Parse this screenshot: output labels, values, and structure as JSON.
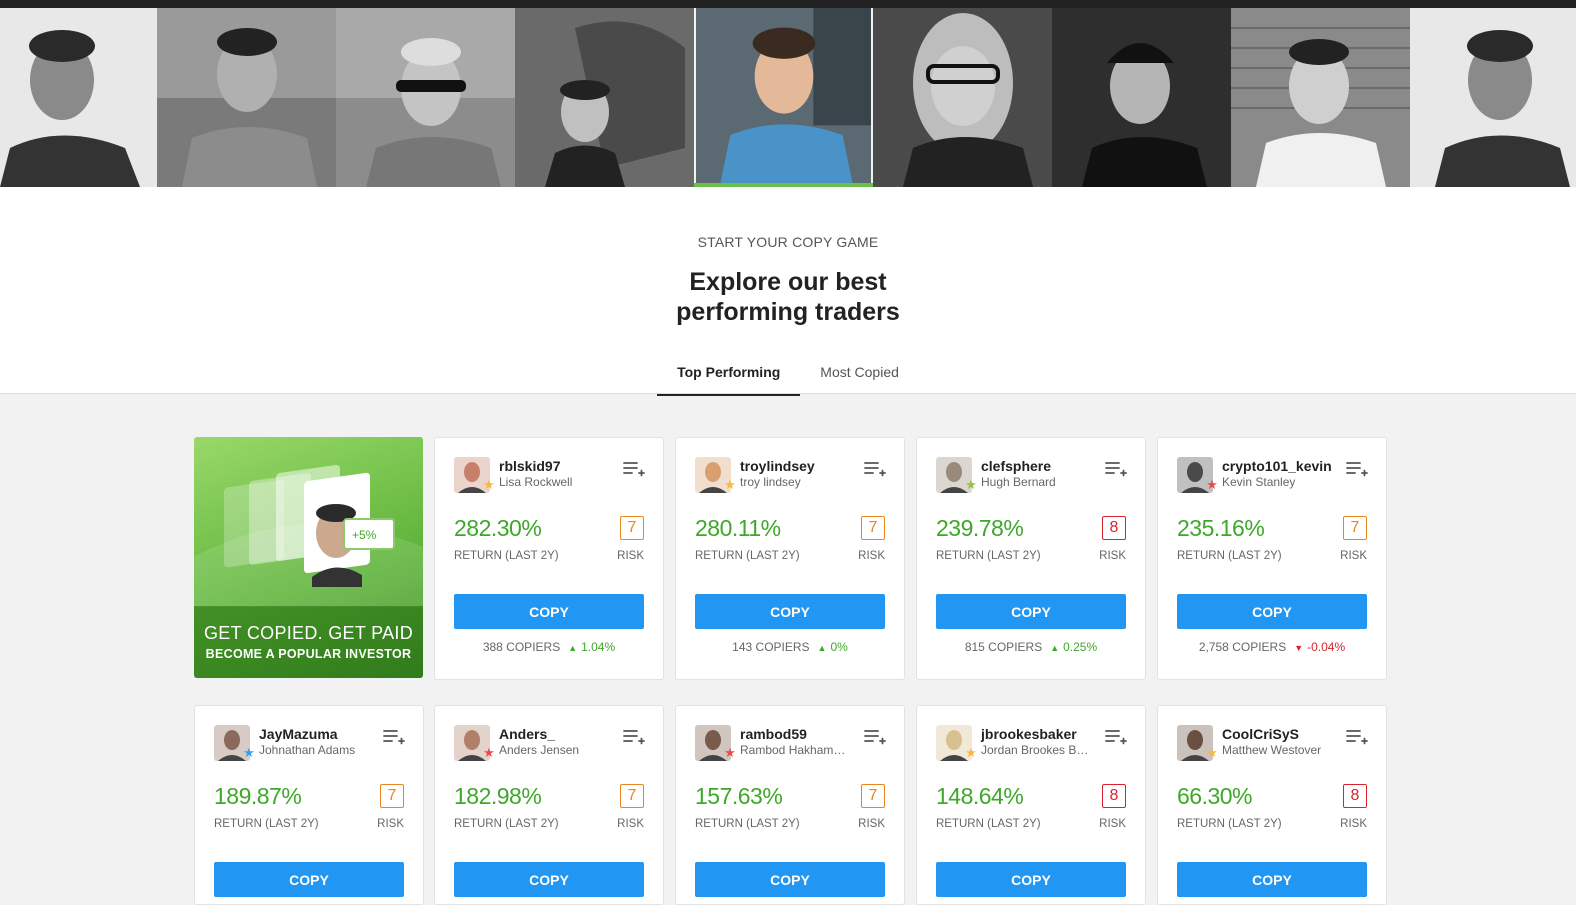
{
  "hero": {
    "kicker": "START YOUR COPY GAME",
    "headline_line1": "Explore our best",
    "headline_line2": "performing traders"
  },
  "tabs": [
    {
      "label": "Top Performing",
      "active": true
    },
    {
      "label": "Most Copied",
      "active": false
    }
  ],
  "promo": {
    "line1": "GET COPIED. GET PAID",
    "line2": "BECOME A POPULAR INVESTOR",
    "tag": "+5%"
  },
  "traders": [
    {
      "username": "rblskid97",
      "name": "Lisa Rockwell",
      "return": "282.30%",
      "return_label": "RETURN (LAST 2Y)",
      "risk": "7",
      "risk_label": "RISK",
      "copy_label": "COPY",
      "copiers": "388 COPIERS",
      "change": "1.04%",
      "direction": "up",
      "badge_color": "#f5b942"
    },
    {
      "username": "troylindsey",
      "name": "troy lindsey",
      "return": "280.11%",
      "return_label": "RETURN (LAST 2Y)",
      "risk": "7",
      "risk_label": "RISK",
      "copy_label": "COPY",
      "copiers": "143 COPIERS",
      "change": "0%",
      "direction": "up",
      "badge_color": "#f5b942"
    },
    {
      "username": "clefsphere",
      "name": "Hugh Bernard",
      "return": "239.78%",
      "return_label": "RETURN (LAST 2Y)",
      "risk": "8",
      "risk_label": "RISK",
      "copy_label": "COPY",
      "copiers": "815 COPIERS",
      "change": "0.25%",
      "direction": "up",
      "badge_color": "#8dc63f"
    },
    {
      "username": "crypto101_kevin",
      "name": "Kevin Stanley",
      "return": "235.16%",
      "return_label": "RETURN (LAST 2Y)",
      "risk": "7",
      "risk_label": "RISK",
      "copy_label": "COPY",
      "copiers": "2,758 COPIERS",
      "change": "-0.04%",
      "direction": "down",
      "badge_color": "#e84c4c"
    },
    {
      "username": "JayMazuma",
      "name": "Johnathan Adams",
      "return": "189.87%",
      "return_label": "RETURN (LAST 2Y)",
      "risk": "7",
      "risk_label": "RISK",
      "copy_label": "COPY",
      "badge_color": "#3aa0e8"
    },
    {
      "username": "Anders_",
      "name": "Anders Jensen",
      "return": "182.98%",
      "return_label": "RETURN (LAST 2Y)",
      "risk": "7",
      "risk_label": "RISK",
      "copy_label": "COPY",
      "badge_color": "#e84c4c"
    },
    {
      "username": "rambod59",
      "name": "Rambod Hakhamanesh",
      "return": "157.63%",
      "return_label": "RETURN (LAST 2Y)",
      "risk": "7",
      "risk_label": "RISK",
      "copy_label": "COPY",
      "badge_color": "#e84c4c"
    },
    {
      "username": "jbrookesbaker",
      "name": "Jordan Brookes Baker",
      "return": "148.64%",
      "return_label": "RETURN (LAST 2Y)",
      "risk": "8",
      "risk_label": "RISK",
      "copy_label": "COPY",
      "badge_color": "#f5b942"
    },
    {
      "username": "CoolCriSyS",
      "name": "Matthew Westover",
      "return": "66.30%",
      "return_label": "RETURN (LAST 2Y)",
      "risk": "8",
      "risk_label": "RISK",
      "copy_label": "COPY",
      "badge_color": "#f5b942"
    }
  ]
}
